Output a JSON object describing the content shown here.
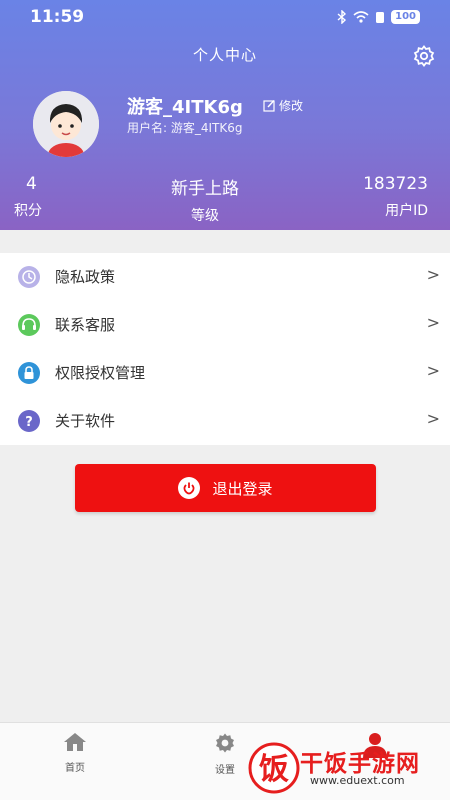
{
  "status_bar": {
    "time": "11:59",
    "battery": "100"
  },
  "header": {
    "title": "个人中心"
  },
  "profile": {
    "username": "游客_4ITK6g",
    "edit_label": "修改",
    "user_sub": "用户名: 游客_4ITK6g"
  },
  "stats": [
    {
      "value": "4",
      "label": "积分"
    },
    {
      "value": "新手上路",
      "label": "等级"
    },
    {
      "value": "183723",
      "label": "用户ID"
    }
  ],
  "menu": [
    {
      "label": "隐私政策",
      "icon": "privacy-icon",
      "color": "#b8b2e8"
    },
    {
      "label": "联系客服",
      "icon": "customer-service-icon",
      "color": "#5cc95c"
    },
    {
      "label": "权限授权管理",
      "icon": "lock-icon",
      "color": "#2f93d8"
    },
    {
      "label": "关于软件",
      "icon": "question-icon",
      "color": "#6a67c9"
    }
  ],
  "logout": {
    "label": "退出登录"
  },
  "tabbar": {
    "home_label": "首页",
    "settings_label": "设置"
  },
  "watermark": {
    "brand": "干饭手游网",
    "url": "www.eduext.com",
    "logo_char": "饭"
  },
  "colors": {
    "header_top": "#6a83e6",
    "header_bottom": "#8a63c4",
    "logout": "#ee1111"
  }
}
